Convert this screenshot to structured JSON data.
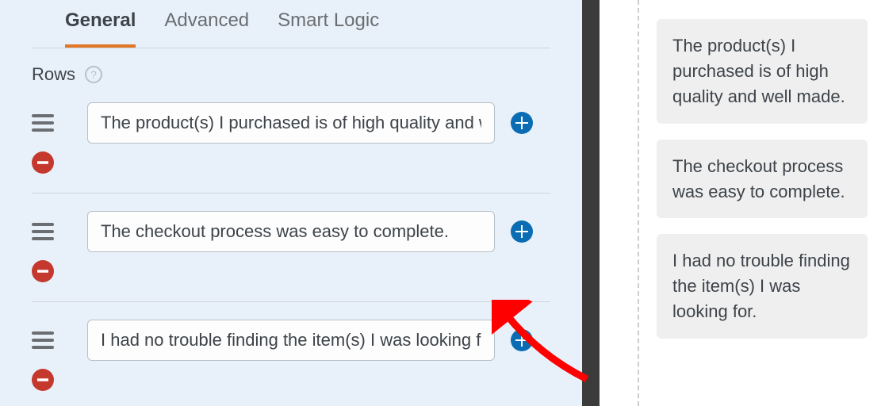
{
  "tabs": {
    "general": "General",
    "advanced": "Advanced",
    "smart_logic": "Smart Logic"
  },
  "rows": {
    "label": "Rows",
    "items": [
      {
        "value": "The product(s) I purchased is of high quality and well made."
      },
      {
        "value": "The checkout process was easy to complete."
      },
      {
        "value": "I had no trouble finding the item(s) I was looking for."
      }
    ]
  },
  "preview": {
    "items": [
      {
        "text": "The product(s) I purchased is of high quality and well made."
      },
      {
        "text": "The checkout process was easy to complete."
      },
      {
        "text": "I had no trouble finding the item(s) I was looking for."
      }
    ]
  },
  "colors": {
    "accent": "#e27627",
    "add": "#0a6db3",
    "remove": "#c5382e",
    "panel_bg": "#e8f1fa"
  }
}
